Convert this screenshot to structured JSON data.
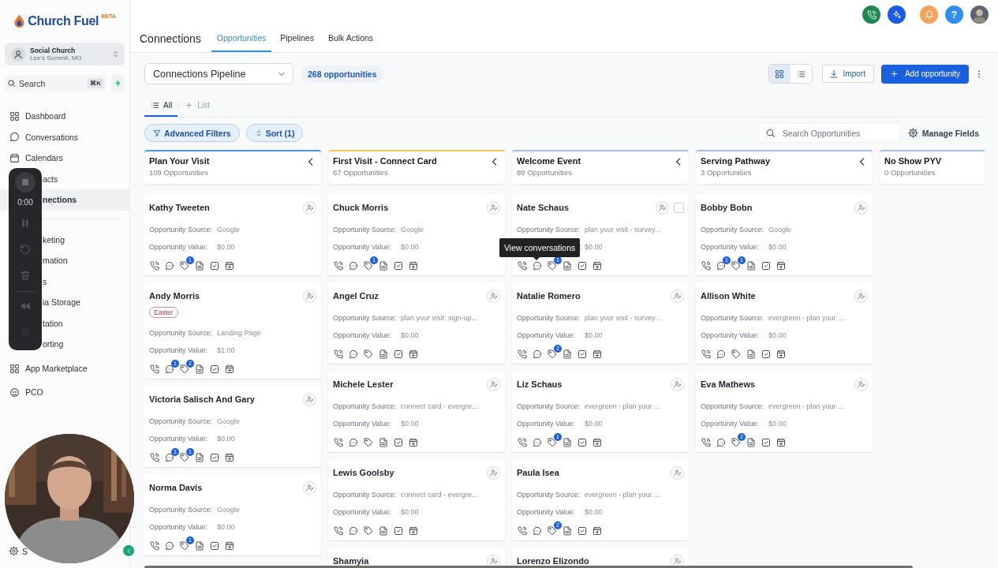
{
  "sidebar": {
    "logo": {
      "name": "Church Fuel",
      "badge": "BETA"
    },
    "account": {
      "name": "Social Church",
      "location": "Lee's Summit, MO"
    },
    "search": {
      "placeholder": "Search",
      "shortcut": "⌘K"
    },
    "nav_groups": [
      {
        "items": [
          {
            "label": "Dashboard",
            "kind": "link",
            "selected": false
          },
          {
            "label": "Conversations",
            "kind": "link",
            "selected": false
          },
          {
            "label": "Calendars",
            "kind": "link",
            "selected": false
          },
          {
            "label": "acts",
            "kind": "covered",
            "selected": false
          },
          {
            "label": "nections",
            "kind": "covered",
            "selected": true
          }
        ]
      },
      {
        "items": [
          {
            "label": "keting",
            "kind": "covered",
            "selected": false
          },
          {
            "label": "mation",
            "kind": "covered",
            "selected": false
          },
          {
            "label": "s",
            "kind": "covered",
            "selected": false
          },
          {
            "label": "ia Storage",
            "kind": "covered",
            "selected": false
          },
          {
            "label": "tation",
            "kind": "covered",
            "selected": false
          },
          {
            "label": "orting",
            "kind": "covered",
            "selected": false
          }
        ]
      },
      {
        "items": [
          {
            "label": "App Marketplace",
            "kind": "link",
            "selected": false
          },
          {
            "label": "PCO",
            "kind": "link",
            "selected": false
          }
        ]
      }
    ],
    "settings": {
      "label": "S"
    }
  },
  "recorder": {
    "time": "0:00"
  },
  "header": {
    "title": "Connections",
    "tabs": [
      {
        "label": "Opportunities",
        "selected": true
      },
      {
        "label": "Pipelines",
        "selected": false
      },
      {
        "label": "Bulk Actions",
        "selected": false
      }
    ],
    "help": "?"
  },
  "toolbar": {
    "pipeline": "Connections Pipeline",
    "count": "268 opportunities",
    "views": [
      {
        "kind": "grid",
        "selected": true
      },
      {
        "kind": "list",
        "selected": false
      }
    ],
    "import": "Import",
    "add": "Add opportunity"
  },
  "subtabs": [
    {
      "label": "All",
      "kind": "view",
      "selected": true
    },
    {
      "label": "List",
      "kind": "add",
      "selected": false
    }
  ],
  "filters": {
    "buttons": [
      {
        "label": "Advanced Filters",
        "kind": "filter"
      },
      {
        "label": "Sort (1)",
        "kind": "sort"
      }
    ],
    "search_placeholder": "Search Opportunities",
    "manage": "Manage Fields"
  },
  "columns": [
    {
      "title": "Plan Your Visit",
      "count": "109 Opportunities",
      "color": "#4a97dd",
      "collapse_shown": true,
      "cards": [
        {
          "name": "Kathy Tweeten",
          "hovered": false,
          "fields": [
            {
              "label": "Opportunity Source:",
              "value": "Google"
            },
            {
              "label": "Opportunity Value:",
              "value": "$0.00"
            }
          ],
          "tag_badge": "1"
        },
        {
          "name": "Andy Morris",
          "hovered": false,
          "tags": [
            "Easter"
          ],
          "fields": [
            {
              "label": "Opportunity Source:",
              "value": "Landing Page"
            },
            {
              "label": "Opportunity Value:",
              "value": "$1.00"
            }
          ],
          "chat_badge": "1",
          "tag_badge": "2"
        },
        {
          "name": "Victoria Salisch And Gary",
          "hovered": false,
          "fields": [
            {
              "label": "Opportunity Source:",
              "value": "Google"
            },
            {
              "label": "Opportunity Value:",
              "value": "$0.00"
            }
          ],
          "chat_badge": "1",
          "tag_badge": "1"
        },
        {
          "name": "Norma Davis",
          "hovered": false,
          "fields": [
            {
              "label": "Opportunity Source:",
              "value": "Google"
            },
            {
              "label": "Opportunity Value:",
              "value": "$0.00"
            }
          ],
          "tag_badge": "1"
        }
      ]
    },
    {
      "title": "First Visit - Connect Card",
      "count": "67 Opportunities",
      "color": "#f2c94c",
      "collapse_shown": true,
      "cards": [
        {
          "name": "Chuck Morris",
          "hovered": false,
          "fields": [
            {
              "label": "Opportunity Source:",
              "value": "Google"
            },
            {
              "label": "Opportunity Value:",
              "value": "$0.00"
            }
          ],
          "tag_badge": "1"
        },
        {
          "name": "Angel Cruz",
          "hovered": false,
          "fields": [
            {
              "label": "Opportunity Source:",
              "value": "plan your visit: sign-up..."
            },
            {
              "label": "Opportunity Value:",
              "value": "$0.00"
            }
          ]
        },
        {
          "name": "Michele Lester",
          "hovered": false,
          "fields": [
            {
              "label": "Opportunity Source:",
              "value": "connect card - evergre..."
            },
            {
              "label": "Opportunity Value:",
              "value": "$0.00"
            }
          ]
        },
        {
          "name": "Lewis Goolsby",
          "hovered": false,
          "fields": [
            {
              "label": "Opportunity Source:",
              "value": "connect card - evergre..."
            },
            {
              "label": "Opportunity Value:",
              "value": "$0.00"
            }
          ]
        },
        {
          "name": "Shamyia",
          "hovered": false
        }
      ]
    },
    {
      "title": "Welcome Event",
      "count": "89 Opportunities",
      "color": "#a8bde3",
      "collapse_shown": true,
      "cards": [
        {
          "name": "Nate Schaus",
          "hovered": true,
          "fields": [
            {
              "label": "Opportunity Source:",
              "value": "plan your visit - survey..."
            },
            {
              "label": ":",
              "value": "$0.00",
              "covered": true
            }
          ],
          "tag_badge": "1",
          "tooltip": "View conversations"
        },
        {
          "name": "Natalie Romero",
          "hovered": false,
          "fields": [
            {
              "label": "Opportunity Source:",
              "value": "plan your visit - survey..."
            },
            {
              "label": "Opportunity Value:",
              "value": "$0.00"
            }
          ],
          "tag_badge": "2"
        },
        {
          "name": "Liz Schaus",
          "hovered": false,
          "fields": [
            {
              "label": "Opportunity Source:",
              "value": "evergreen - plan your ..."
            },
            {
              "label": "Opportunity Value:",
              "value": "$0.00"
            }
          ],
          "tag_badge": "1"
        },
        {
          "name": "Paula Isea",
          "hovered": false,
          "fields": [
            {
              "label": "Opportunity Source:",
              "value": "evergreen - plan your ..."
            },
            {
              "label": "Opportunity Value:",
              "value": "$0.00"
            }
          ],
          "tag_badge": "2"
        },
        {
          "name": "Lorenzo Elizondo",
          "hovered": false
        }
      ]
    },
    {
      "title": "Serving Pathway",
      "count": "3 Opportunities",
      "color": "#a8bde3",
      "collapse_shown": true,
      "cards": [
        {
          "name": "Bobby Bobn",
          "hovered": false,
          "fields": [
            {
              "label": "Opportunity Source:",
              "value": "Google"
            },
            {
              "label": "Opportunity Value:",
              "value": "$0.00"
            }
          ],
          "chat_badge": "1",
          "tag_badge": "1"
        },
        {
          "name": "Allison White",
          "hovered": false,
          "fields": [
            {
              "label": "Opportunity Source:",
              "value": "evergreen - plan your ..."
            },
            {
              "label": "Opportunity Value:",
              "value": "$0.00"
            }
          ]
        },
        {
          "name": "Eva Mathews",
          "hovered": false,
          "fields": [
            {
              "label": "Opportunity Source:",
              "value": "evergreen - plan your ..."
            },
            {
              "label": "Opportunity Value:",
              "value": "$0.00"
            }
          ],
          "tag_badge": "2"
        }
      ]
    },
    {
      "title": "No Show PYV",
      "count": "0 Opportunities",
      "color": "#a8bde3",
      "collapse_shown": false
    }
  ]
}
